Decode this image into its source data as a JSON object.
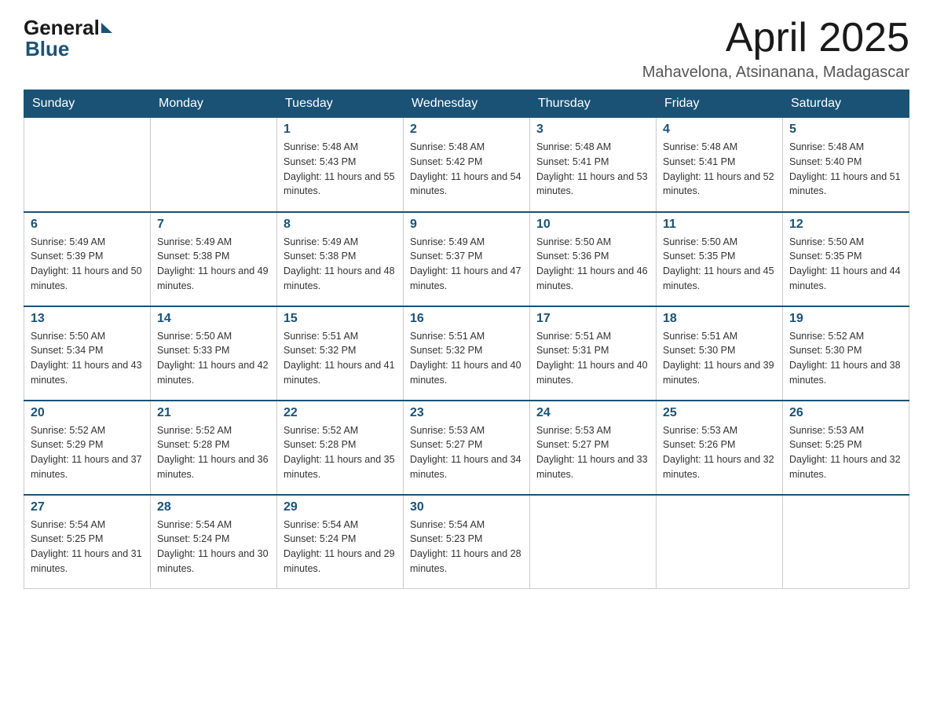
{
  "header": {
    "logo_general": "General",
    "logo_blue": "Blue",
    "month_title": "April 2025",
    "location": "Mahavelona, Atsinanana, Madagascar"
  },
  "days_of_week": [
    "Sunday",
    "Monday",
    "Tuesday",
    "Wednesday",
    "Thursday",
    "Friday",
    "Saturday"
  ],
  "weeks": [
    [
      {
        "day": "",
        "sunrise": "",
        "sunset": "",
        "daylight": ""
      },
      {
        "day": "",
        "sunrise": "",
        "sunset": "",
        "daylight": ""
      },
      {
        "day": "1",
        "sunrise": "Sunrise: 5:48 AM",
        "sunset": "Sunset: 5:43 PM",
        "daylight": "Daylight: 11 hours and 55 minutes."
      },
      {
        "day": "2",
        "sunrise": "Sunrise: 5:48 AM",
        "sunset": "Sunset: 5:42 PM",
        "daylight": "Daylight: 11 hours and 54 minutes."
      },
      {
        "day": "3",
        "sunrise": "Sunrise: 5:48 AM",
        "sunset": "Sunset: 5:41 PM",
        "daylight": "Daylight: 11 hours and 53 minutes."
      },
      {
        "day": "4",
        "sunrise": "Sunrise: 5:48 AM",
        "sunset": "Sunset: 5:41 PM",
        "daylight": "Daylight: 11 hours and 52 minutes."
      },
      {
        "day": "5",
        "sunrise": "Sunrise: 5:48 AM",
        "sunset": "Sunset: 5:40 PM",
        "daylight": "Daylight: 11 hours and 51 minutes."
      }
    ],
    [
      {
        "day": "6",
        "sunrise": "Sunrise: 5:49 AM",
        "sunset": "Sunset: 5:39 PM",
        "daylight": "Daylight: 11 hours and 50 minutes."
      },
      {
        "day": "7",
        "sunrise": "Sunrise: 5:49 AM",
        "sunset": "Sunset: 5:38 PM",
        "daylight": "Daylight: 11 hours and 49 minutes."
      },
      {
        "day": "8",
        "sunrise": "Sunrise: 5:49 AM",
        "sunset": "Sunset: 5:38 PM",
        "daylight": "Daylight: 11 hours and 48 minutes."
      },
      {
        "day": "9",
        "sunrise": "Sunrise: 5:49 AM",
        "sunset": "Sunset: 5:37 PM",
        "daylight": "Daylight: 11 hours and 47 minutes."
      },
      {
        "day": "10",
        "sunrise": "Sunrise: 5:50 AM",
        "sunset": "Sunset: 5:36 PM",
        "daylight": "Daylight: 11 hours and 46 minutes."
      },
      {
        "day": "11",
        "sunrise": "Sunrise: 5:50 AM",
        "sunset": "Sunset: 5:35 PM",
        "daylight": "Daylight: 11 hours and 45 minutes."
      },
      {
        "day": "12",
        "sunrise": "Sunrise: 5:50 AM",
        "sunset": "Sunset: 5:35 PM",
        "daylight": "Daylight: 11 hours and 44 minutes."
      }
    ],
    [
      {
        "day": "13",
        "sunrise": "Sunrise: 5:50 AM",
        "sunset": "Sunset: 5:34 PM",
        "daylight": "Daylight: 11 hours and 43 minutes."
      },
      {
        "day": "14",
        "sunrise": "Sunrise: 5:50 AM",
        "sunset": "Sunset: 5:33 PM",
        "daylight": "Daylight: 11 hours and 42 minutes."
      },
      {
        "day": "15",
        "sunrise": "Sunrise: 5:51 AM",
        "sunset": "Sunset: 5:32 PM",
        "daylight": "Daylight: 11 hours and 41 minutes."
      },
      {
        "day": "16",
        "sunrise": "Sunrise: 5:51 AM",
        "sunset": "Sunset: 5:32 PM",
        "daylight": "Daylight: 11 hours and 40 minutes."
      },
      {
        "day": "17",
        "sunrise": "Sunrise: 5:51 AM",
        "sunset": "Sunset: 5:31 PM",
        "daylight": "Daylight: 11 hours and 40 minutes."
      },
      {
        "day": "18",
        "sunrise": "Sunrise: 5:51 AM",
        "sunset": "Sunset: 5:30 PM",
        "daylight": "Daylight: 11 hours and 39 minutes."
      },
      {
        "day": "19",
        "sunrise": "Sunrise: 5:52 AM",
        "sunset": "Sunset: 5:30 PM",
        "daylight": "Daylight: 11 hours and 38 minutes."
      }
    ],
    [
      {
        "day": "20",
        "sunrise": "Sunrise: 5:52 AM",
        "sunset": "Sunset: 5:29 PM",
        "daylight": "Daylight: 11 hours and 37 minutes."
      },
      {
        "day": "21",
        "sunrise": "Sunrise: 5:52 AM",
        "sunset": "Sunset: 5:28 PM",
        "daylight": "Daylight: 11 hours and 36 minutes."
      },
      {
        "day": "22",
        "sunrise": "Sunrise: 5:52 AM",
        "sunset": "Sunset: 5:28 PM",
        "daylight": "Daylight: 11 hours and 35 minutes."
      },
      {
        "day": "23",
        "sunrise": "Sunrise: 5:53 AM",
        "sunset": "Sunset: 5:27 PM",
        "daylight": "Daylight: 11 hours and 34 minutes."
      },
      {
        "day": "24",
        "sunrise": "Sunrise: 5:53 AM",
        "sunset": "Sunset: 5:27 PM",
        "daylight": "Daylight: 11 hours and 33 minutes."
      },
      {
        "day": "25",
        "sunrise": "Sunrise: 5:53 AM",
        "sunset": "Sunset: 5:26 PM",
        "daylight": "Daylight: 11 hours and 32 minutes."
      },
      {
        "day": "26",
        "sunrise": "Sunrise: 5:53 AM",
        "sunset": "Sunset: 5:25 PM",
        "daylight": "Daylight: 11 hours and 32 minutes."
      }
    ],
    [
      {
        "day": "27",
        "sunrise": "Sunrise: 5:54 AM",
        "sunset": "Sunset: 5:25 PM",
        "daylight": "Daylight: 11 hours and 31 minutes."
      },
      {
        "day": "28",
        "sunrise": "Sunrise: 5:54 AM",
        "sunset": "Sunset: 5:24 PM",
        "daylight": "Daylight: 11 hours and 30 minutes."
      },
      {
        "day": "29",
        "sunrise": "Sunrise: 5:54 AM",
        "sunset": "Sunset: 5:24 PM",
        "daylight": "Daylight: 11 hours and 29 minutes."
      },
      {
        "day": "30",
        "sunrise": "Sunrise: 5:54 AM",
        "sunset": "Sunset: 5:23 PM",
        "daylight": "Daylight: 11 hours and 28 minutes."
      },
      {
        "day": "",
        "sunrise": "",
        "sunset": "",
        "daylight": ""
      },
      {
        "day": "",
        "sunrise": "",
        "sunset": "",
        "daylight": ""
      },
      {
        "day": "",
        "sunrise": "",
        "sunset": "",
        "daylight": ""
      }
    ]
  ]
}
